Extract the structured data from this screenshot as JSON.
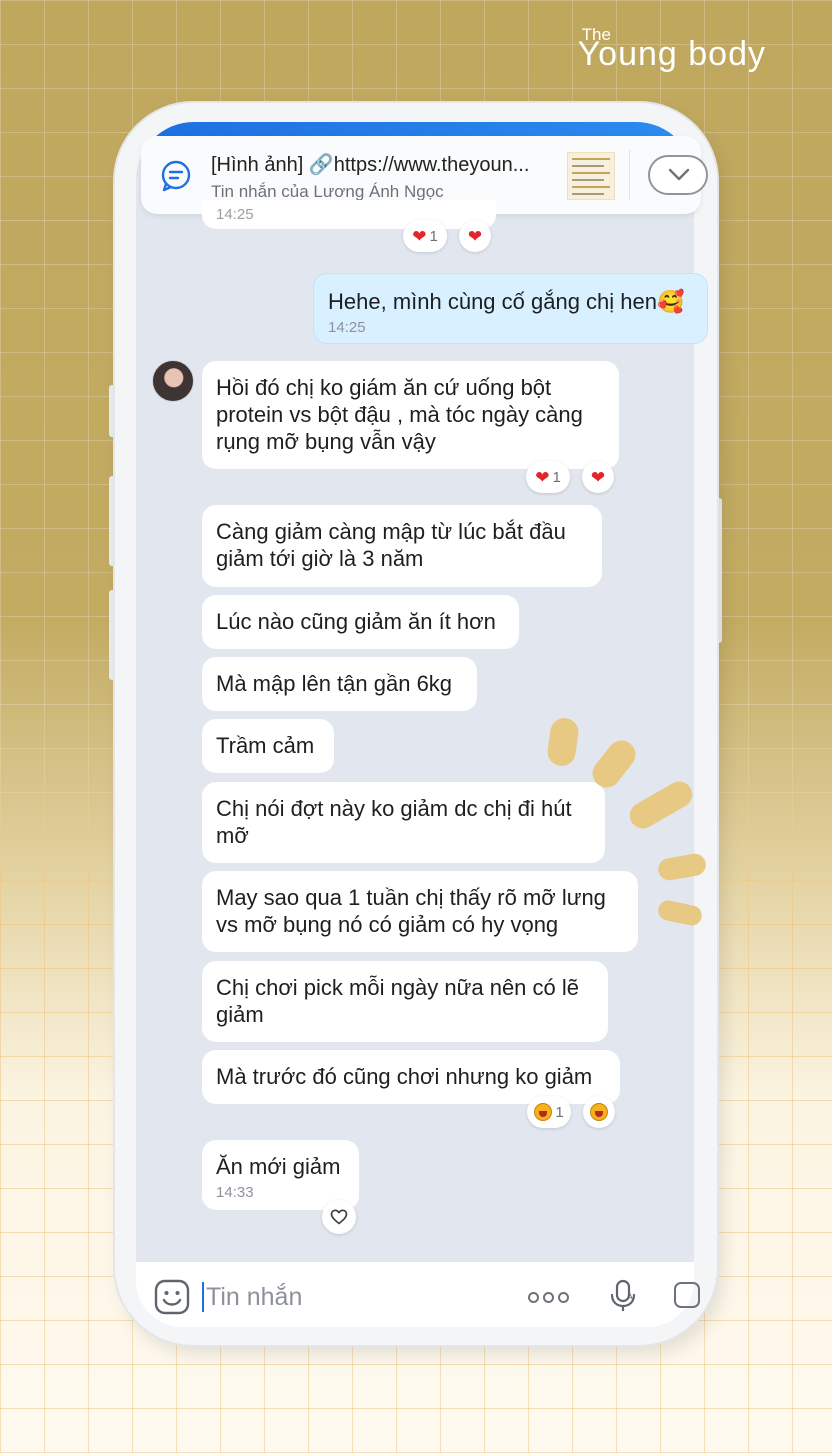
{
  "brand": {
    "the": "The",
    "name": "Young body"
  },
  "pinned": {
    "title": "[Hình ảnh] 🔗https://www.theyoun...",
    "subtitle": "Tin nhắn của Lương Ánh Ngọc"
  },
  "partial_time": "14:25",
  "messages": [
    {
      "id": "m1",
      "side": "out",
      "text": "Hehe, mình cùng cố gắng chị hen🥰",
      "time": "14:25"
    },
    {
      "id": "m2",
      "side": "in",
      "text": "Hồi đó chị ko giám ăn cứ uống bột protein vs bột đậu , mà tóc ngày càng rụng mỡ bụng vẫn vậy"
    },
    {
      "id": "m3",
      "side": "in",
      "text": "Càng giảm càng mập từ lúc bắt đầu giảm tới giờ là 3 năm"
    },
    {
      "id": "m4",
      "side": "in",
      "text": "Lúc nào cũng giảm ăn ít hơn"
    },
    {
      "id": "m5",
      "side": "in",
      "text": "Mà mập lên tận gần 6kg"
    },
    {
      "id": "m6",
      "side": "in",
      "text": "Trầm cảm"
    },
    {
      "id": "m7",
      "side": "in",
      "text": "Chị nói đợt này ko giảm dc chị đi hút mỡ"
    },
    {
      "id": "m8",
      "side": "in",
      "text": "May sao qua 1 tuần chị thấy rõ mỡ lưng vs mỡ bụng nó có giảm có hy vọng"
    },
    {
      "id": "m9",
      "side": "in",
      "text": "Chị chơi pick mỗi ngày nữa nên có lẽ giảm"
    },
    {
      "id": "m10",
      "side": "in",
      "text": "Mà trước đó cũng chơi nhưng ko giảm"
    },
    {
      "id": "m11",
      "side": "in",
      "text": "Ăn mới giảm",
      "time": "14:33"
    }
  ],
  "reactions": {
    "top": {
      "icon": "heart",
      "count": "1"
    },
    "m2": {
      "icon": "heart",
      "count": "1"
    },
    "m10": {
      "icon": "laugh",
      "count": "1"
    }
  },
  "input": {
    "placeholder": "Tin nhắn"
  },
  "colors": {
    "accent": "#1f6fe5",
    "own_bubble": "#d8f0ff",
    "chat_bg": "#e2e6ef",
    "background": "#bfa75e"
  }
}
